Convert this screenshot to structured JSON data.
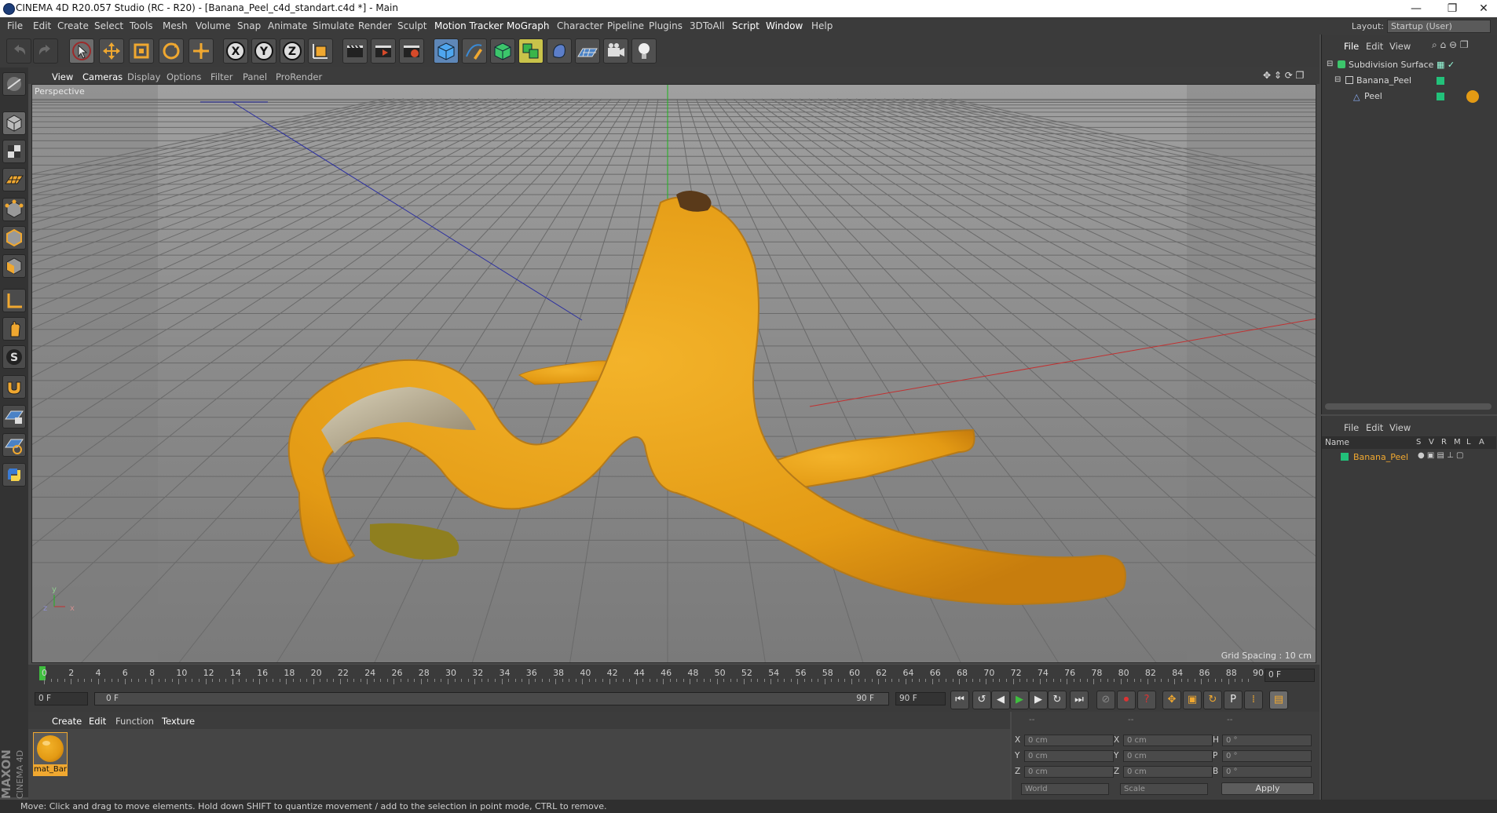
{
  "window": {
    "title": "CINEMA 4D R20.057 Studio (RC - R20) - [Banana_Peel_c4d_standart.c4d *] - Main",
    "minimize": "—",
    "restore": "❐",
    "close": "✕"
  },
  "menubar": {
    "items": [
      "File",
      "Edit",
      "Create",
      "Select",
      "Tools",
      "Mesh",
      "Volume",
      "Snap",
      "Animate",
      "Simulate",
      "Render",
      "Sculpt",
      "Motion Tracker",
      "MoGraph",
      "Character",
      "Pipeline",
      "Plugins",
      "3DToAll",
      "Script",
      "Window",
      "Help"
    ],
    "layout_label": "Layout:",
    "layout_value": "Startup (User)"
  },
  "viewport": {
    "menu": [
      "View",
      "Cameras",
      "Display",
      "Options",
      "Filter",
      "Panel",
      "ProRender"
    ],
    "label": "Perspective",
    "grid_spacing": "Grid Spacing : 10 cm",
    "axis_y": "y",
    "axis_z": "z",
    "axis_x": "x"
  },
  "timeline": {
    "ticks": [
      "0",
      "2",
      "4",
      "6",
      "8",
      "10",
      "12",
      "14",
      "16",
      "18",
      "20",
      "22",
      "24",
      "26",
      "28",
      "30",
      "32",
      "34",
      "36",
      "38",
      "40",
      "42",
      "44",
      "46",
      "48",
      "50",
      "52",
      "54",
      "56",
      "58",
      "60",
      "62",
      "64",
      "66",
      "68",
      "70",
      "72",
      "74",
      "76",
      "78",
      "80",
      "82",
      "84",
      "86",
      "88",
      "90"
    ],
    "current_frame_right": "0 F",
    "start_field": "0 F",
    "range_start": "0 F",
    "range_end": "90 F",
    "end_field": "90 F"
  },
  "material_manager": {
    "menu": [
      "Create",
      "Edit",
      "Function",
      "Texture"
    ],
    "material_name": "mat_Bar"
  },
  "coordinates": {
    "row_labels_left": [
      "X",
      "Y",
      "Z"
    ],
    "row_labels_mid": [
      "X",
      "Y",
      "Z"
    ],
    "row_labels_right": [
      "H",
      "P",
      "B"
    ],
    "pos_values": [
      "0 cm",
      "0 cm",
      "0 cm"
    ],
    "size_values": [
      "0 cm",
      "0 cm",
      "0 cm"
    ],
    "rot_values": [
      "0 °",
      "0 °",
      "0 °"
    ],
    "header_left": "--",
    "header_mid": "--",
    "header_right": "--",
    "mode_world": "World",
    "mode_scale": "Scale",
    "apply": "Apply"
  },
  "object_manager": {
    "menu": [
      "File",
      "Edit",
      "View"
    ],
    "objects": [
      "Subdivision Surface",
      "Banana_Peel",
      "Peel"
    ]
  },
  "layer_manager": {
    "menu": [
      "File",
      "Edit",
      "View"
    ],
    "col_name": "Name",
    "cols": [
      "S",
      "V",
      "R",
      "M",
      "L",
      "A"
    ],
    "rows": [
      "Banana_Peel"
    ]
  },
  "statusbar": {
    "text": "Move: Click and drag to move elements. Hold down SHIFT to quantize movement / add to the selection in point mode, CTRL to remove."
  },
  "colors": {
    "accent_orange": "#f0a830",
    "object_green": "#22c17a",
    "banana": "#e8a51c"
  }
}
